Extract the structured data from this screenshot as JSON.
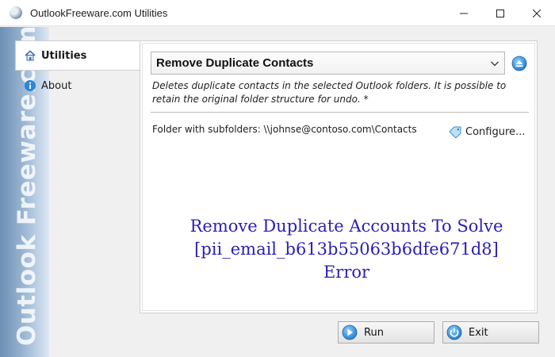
{
  "window": {
    "title": "OutlookFreeware.com Utilities"
  },
  "brand": {
    "text": "Outlook Freeware.com"
  },
  "tabs": [
    {
      "label": "Utilities",
      "icon": "home-icon",
      "active": true
    },
    {
      "label": "About",
      "icon": "info-icon",
      "active": false
    }
  ],
  "utility": {
    "selected": "Remove Duplicate Contacts",
    "description": "Deletes duplicate contacts in the selected Outlook folders. It is possible to retain the original folder structure for undo. *",
    "folder_text": "Folder with subfolders: \\\\johnse@contoso.com\\Contacts",
    "configure_label": "Configure..."
  },
  "overlay": {
    "line1": "Remove Duplicate Accounts To Solve",
    "line2": "[pii_email_b613b55063b6dfe671d8]",
    "line3": "Error"
  },
  "buttons": {
    "run_label": "Run",
    "exit_label": "Exit"
  },
  "colors": {
    "overlay_text": "#2a1fb5",
    "brand_strip": "#97b3d1",
    "accent_blue": "#2f86d6"
  }
}
